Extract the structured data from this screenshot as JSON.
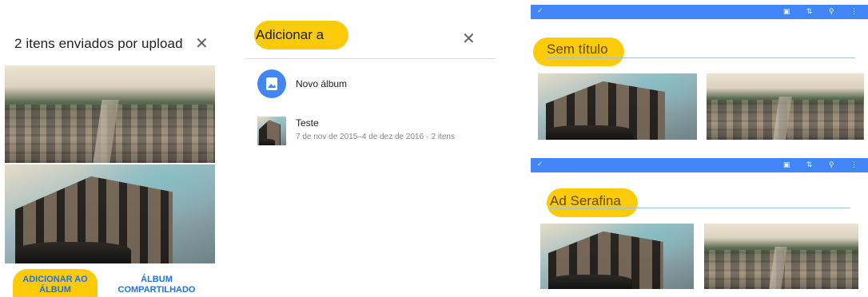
{
  "upload_panel": {
    "title": "2 itens enviados por upload",
    "close": "✕",
    "add_to_album_line1": "ADICIONAR AO",
    "add_to_album_line2": "ÁLBUM",
    "shared_album_line1": "ÁLBUM",
    "shared_album_line2": "COMPARTILHADO"
  },
  "add_to_panel": {
    "title": "Adicionar a",
    "close": "✕",
    "new_album": "Novo álbum",
    "albums": [
      {
        "name": "Teste",
        "dates": "7 de nov de 2015–4 de dez de 2016",
        "separator": "·",
        "count": "2 itens"
      }
    ]
  },
  "preview_top": {
    "check": "✓",
    "tools": "▣ ⇅ ⚲ ⋮",
    "title": "Sem título"
  },
  "preview_bottom": {
    "check": "✓",
    "tools": "▣ ⇅ ⚲ ⋮",
    "title": "Ad Serafina"
  },
  "colors": {
    "highlight": "#fbcb0a",
    "accent": "#1a73e8",
    "bar": "#4285f4"
  }
}
